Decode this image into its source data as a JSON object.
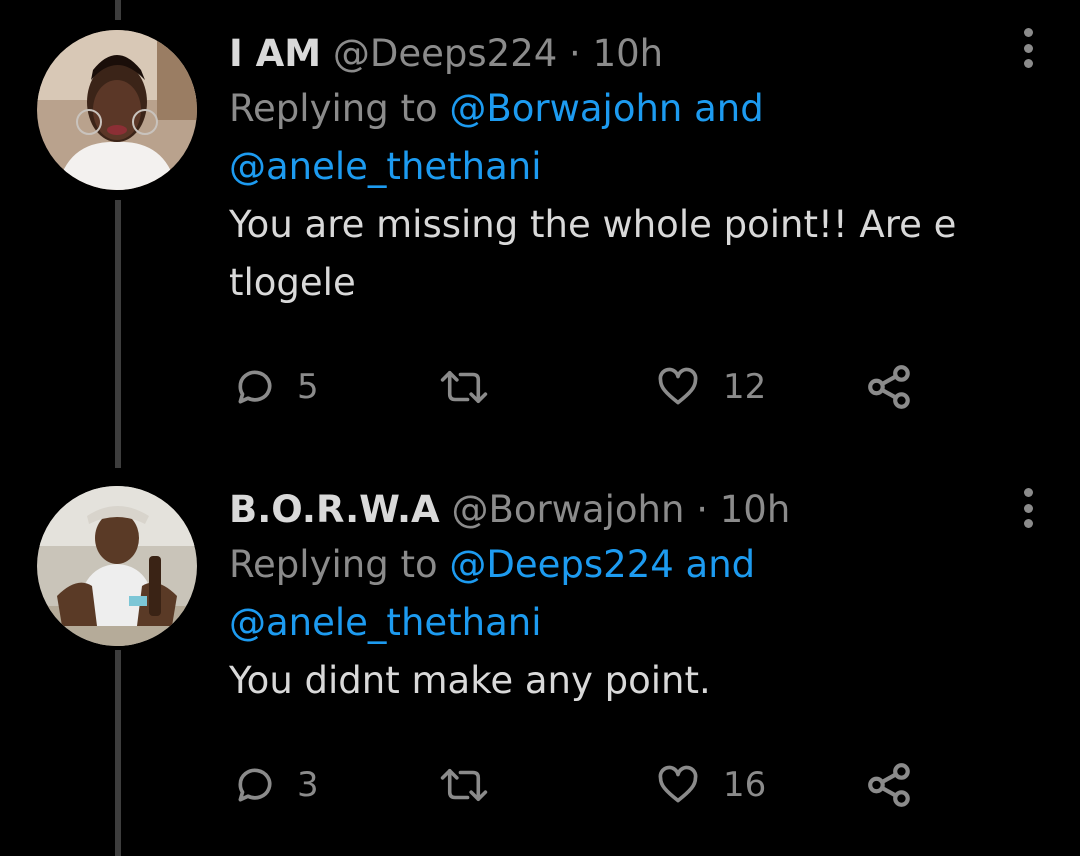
{
  "tweets": [
    {
      "display_name": "I AM",
      "handle": "@Deeps224",
      "separator": "·",
      "time": "10h",
      "replying_prefix": "Replying to",
      "reply_mention_1": "@Borwajohn",
      "reply_and": "and",
      "reply_mention_2": "@anele_thethani",
      "text_line_1": "You are missing the whole point!! Are e",
      "text_line_2": "tlogele",
      "reply_count": "5",
      "like_count": "12",
      "icons": [
        "reply-icon",
        "retweet-icon",
        "like-icon",
        "share-icon",
        "more-options-icon"
      ]
    },
    {
      "display_name": "B.O.R.W.A",
      "handle": "@Borwajohn",
      "separator": "·",
      "time": "10h",
      "replying_prefix": "Replying to",
      "reply_mention_1": "@Deeps224",
      "reply_and": "and",
      "reply_mention_2": "@anele_thethani",
      "text_line_1": "You didnt make any point.",
      "reply_count": "3",
      "like_count": "16",
      "icons": [
        "reply-icon",
        "retweet-icon",
        "like-icon",
        "share-icon",
        "more-options-icon"
      ]
    }
  ],
  "colors": {
    "background": "#000000",
    "primary_text": "#d9d9d9",
    "secondary_text": "#8b8b8b",
    "mention": "#1d9bf0",
    "thread_line": "#3d3d3d"
  }
}
